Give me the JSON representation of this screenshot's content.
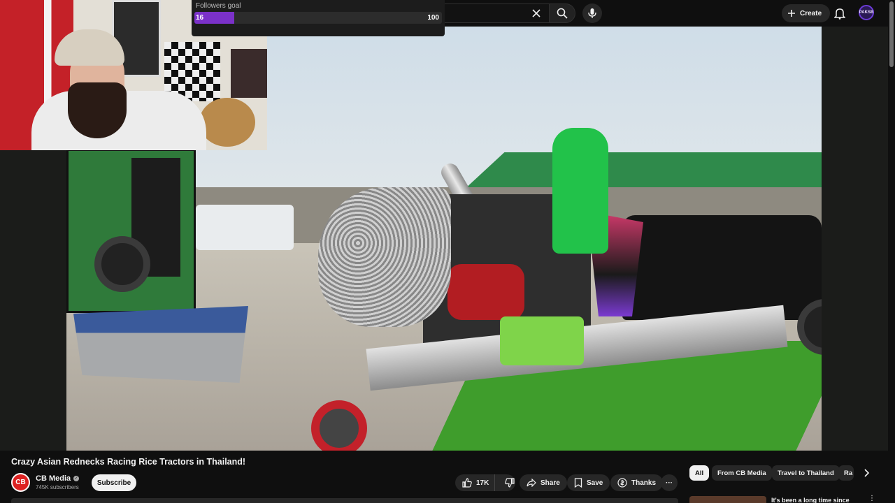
{
  "goal": {
    "title": "Followers goal",
    "current": "16",
    "target": "100",
    "progress": 0.16
  },
  "header": {
    "create_label": "Create",
    "account_initials": "PAKSB"
  },
  "video": {
    "title": "Crazy Asian Rednecks Racing Rice Tractors in Thailand!"
  },
  "channel": {
    "avatar_text": "CB",
    "name": "CB Media",
    "verified_mark": "✓",
    "subscribers": "745K subscribers",
    "subscribe_label": "Subscribe"
  },
  "actions": {
    "likes": "17K",
    "share": "Share",
    "save": "Save",
    "thanks": "Thanks",
    "more": "···"
  },
  "chips": [
    "All",
    "From CB Media",
    "Travel to Thailand",
    "Ra"
  ],
  "recommendation": {
    "title": "It's been a long time since",
    "menu": "⋮"
  },
  "colors": {
    "accent": "#7b31c9",
    "background": "#0f0f0f",
    "pill": "#272727"
  },
  "icons": [
    "clear-icon",
    "search-icon",
    "mic-icon",
    "plus-icon",
    "bell-icon",
    "like-icon",
    "dislike-icon",
    "share-icon",
    "save-icon",
    "thanks-icon",
    "chevron-right-icon"
  ]
}
